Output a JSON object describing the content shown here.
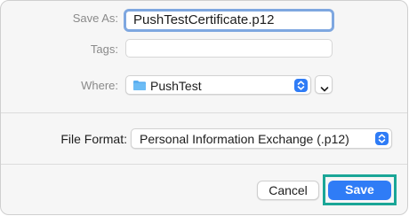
{
  "form": {
    "save_as_label": "Save As:",
    "save_as_value": "PushTestCertificate.p12",
    "tags_label": "Tags:",
    "tags_value": "",
    "where_label": "Where:",
    "where_value": "PushTest",
    "file_format_label": "File Format:",
    "file_format_value": "Personal Information Exchange (.p12)"
  },
  "buttons": {
    "cancel_label": "Cancel",
    "save_label": "Save"
  },
  "icons": {
    "folder": "folder-icon",
    "stepper": "up-down-chevron-icon",
    "expand": "chevron-down-icon"
  },
  "colors": {
    "accent": "#2f7cf6",
    "focus_ring": "#7ea7e0",
    "annotation_highlight": "#1aa697",
    "folder": "#5aaef0"
  }
}
